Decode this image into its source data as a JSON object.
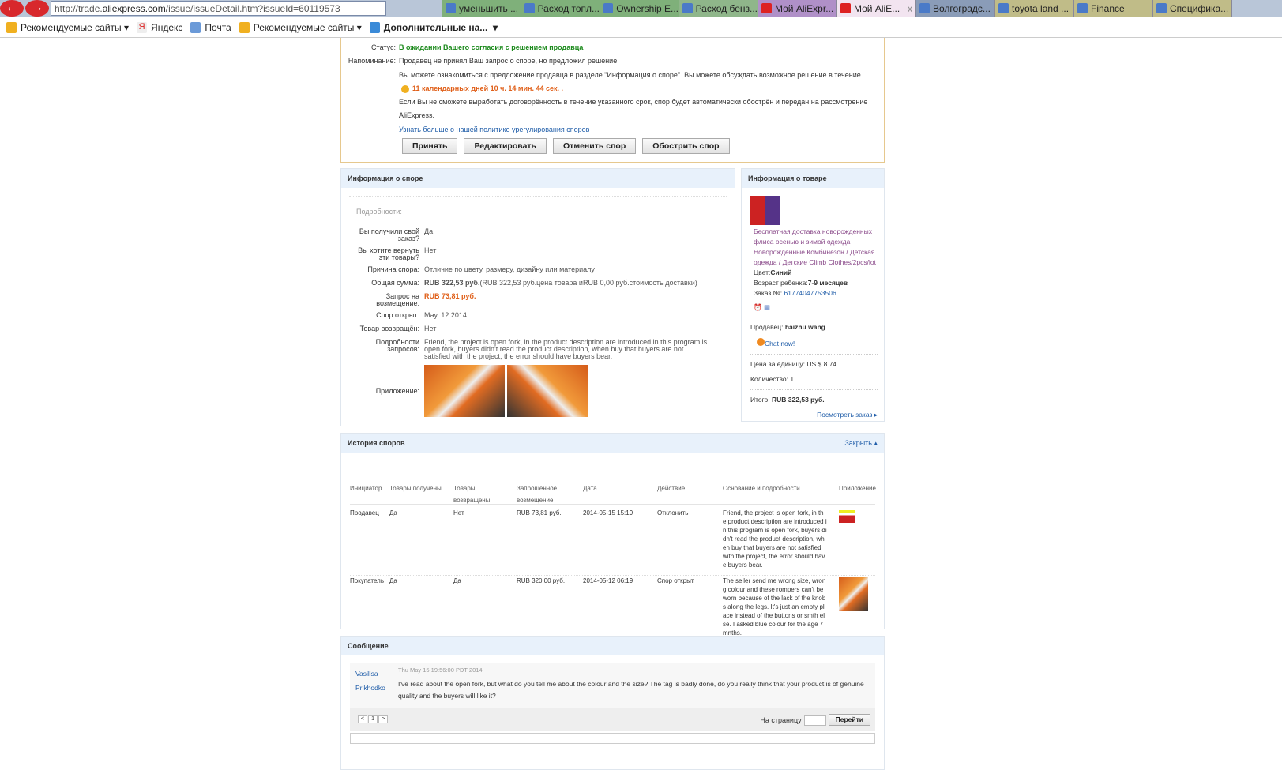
{
  "browser": {
    "url_prefix": "http://trade.",
    "url_domain": "aliexpress.com",
    "url_suffix": "/issue/issueDetail.htm?issueId=60119573",
    "tabs": [
      {
        "label": "уменьшить ...",
        "color": "#7fb07a"
      },
      {
        "label": "Расход топл...",
        "color": "#7fb07a"
      },
      {
        "label": "Ownership E...",
        "color": "#7fb07a"
      },
      {
        "label": "Расход бенз...",
        "color": "#8fb68a"
      },
      {
        "label": "Мой AliExpr...",
        "color": "#b090c8"
      },
      {
        "label": "Мой AliE...",
        "color": "#f2e4f0",
        "active": true
      },
      {
        "label": "Волгоградс...",
        "color": "#8a9cb8"
      },
      {
        "label": "toyota land ...",
        "color": "#c0bc88"
      },
      {
        "label": "Finance",
        "color": "#c0bc88"
      },
      {
        "label": "Специфика...",
        "color": "#c0bc88"
      }
    ],
    "close_tab": "x",
    "bookmarks": [
      "Рекомендуемые сайты",
      "Яндекс",
      "Почта",
      "Рекомендуемые сайты",
      "Дополнительные на..."
    ]
  },
  "alert": {
    "status_label": "Статус:",
    "status": "В ожидании Вашего согласия с решением продавца",
    "reminder_label": "Напоминание:",
    "line1": "Продавец не принял Ваш запрос о споре, но предложил решение.",
    "line2": "Вы можете ознакомиться с предложение продавца в разделе \"Информация о споре\". Вы можете обсуждать возможное решение в течение",
    "timer": "11 календарных дней 10 ч. 14 мин. 44 сек. .",
    "line3": "Если Вы не сможете выработать договорённость в течение указанного срок, спор будет автоматически обострён и передан на рассмотрение",
    "line4": "AliExpress.",
    "policy_link": "Узнать больше о нашей политике урегулирования споров",
    "buttons": [
      "Принять",
      "Редактировать",
      "Отменить спор",
      "Обострить спор"
    ]
  },
  "dispute": {
    "title": "Информация о споре",
    "details": "Подробности:",
    "rows": [
      {
        "l1": "Вы получили свой",
        "l2": "заказ?",
        "v": "Да"
      },
      {
        "l1": "Вы хотите вернуть",
        "l2": "эти товары?",
        "v": "Нет"
      },
      {
        "l1": "Причина спора:",
        "v": "Отличие по цвету, размеру, дизайну или материалу"
      },
      {
        "l1": "Общая сумма:",
        "vb": "RUB 322,53 руб.",
        "v": "(RUB 322,53 руб.цена товара иRUB 0,00 руб.стоимость доставки)"
      },
      {
        "l1": "Запрос на",
        "l2": "возмещение:",
        "vo": "RUB 73,81 руб."
      },
      {
        "l1": "Спор открыт:",
        "v": "May. 12 2014"
      },
      {
        "l1": "Товар возвращён:",
        "v": "Нет"
      },
      {
        "l1": "Подробности",
        "l2": "запросов:",
        "v": "Friend, the project is open fork, in the product description are introduced in this program is open fork, buyers didn't read the product description, when buy that buyers are not satisfied with the project, the error should have buyers bear."
      }
    ],
    "attachment_label": "Приложение:"
  },
  "product": {
    "title": "Информация о товаре",
    "name": "Бесплатная доставка новорожденных флиса осенью и зимой одежда Новорожденные Комбинезон / Детская одежда / Детские Climb Clothes/2pcs/lot",
    "color_label": "Цвет:",
    "color": "Синий",
    "age_label": "Возраст ребенка:",
    "age": "7-9 месяцев",
    "order_label": "Заказ №:",
    "order": "61774047753506",
    "seller_label": "Продавец:",
    "seller": "haizhu wang",
    "chat": "Chat now!",
    "price_label": "Цена за единицу:",
    "price": "US $ 8.74",
    "qty_label": "Количество:",
    "qty": "1",
    "total_label": "Итого:",
    "total": "RUB 322,53 руб.",
    "view_order": "Посмотреть заказ ▸"
  },
  "history": {
    "title": "История споров",
    "close": "Закрыть ▴",
    "headers": [
      "Инициатор",
      "Товары получены",
      "Товары возвращены",
      "Запрошенное возмещение",
      "Дата",
      "Действие",
      "Основание и подробности",
      "Приложение"
    ],
    "rows": [
      [
        "Продавец",
        "Да",
        "Нет",
        "RUB 73,81 руб.",
        "2014-05-15 15:19",
        "Отклонить",
        "Friend, the project is open fork, in the product description are introduced in this program is open fork, buyers didn't read the product description, when buy that buyers are not satisfied with the project, the error should have buyers bear."
      ],
      [
        "Покупатель",
        "Да",
        "Да",
        "RUB 320,00 руб.",
        "2014-05-12 06:19",
        "Спор открыт",
        "The seller send me wrong size, wrong colour and these rompers can't be worn because of the lack of the knobs along the legs. It's just an empty place instead of the buttons or smth else. I asked blue colour for the age 7 mnths."
      ]
    ]
  },
  "message": {
    "title": "Сообщение",
    "author1": "Vasilisa",
    "author2": "Prikhodko",
    "date": "Thu May 15 19:56:00 PDT 2014",
    "text": "I've read about the open fork, but what do you tell me about the colour and the size? The tag is badly done, do you really think that your product is of genuine quality and the buyers will like it?",
    "prev": "<",
    "page": "1",
    "next": ">",
    "goto_label": "На страницу",
    "go": "Перейти"
  }
}
